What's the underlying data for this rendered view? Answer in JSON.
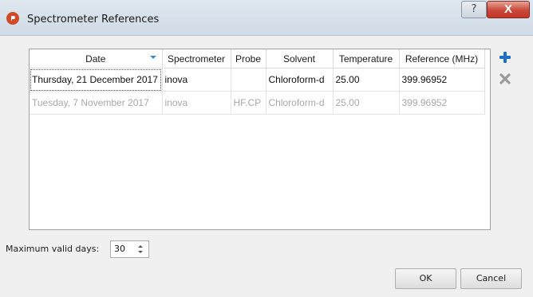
{
  "window": {
    "title": "Spectrometer References",
    "help_label": "?",
    "close_label": "X"
  },
  "table": {
    "columns": [
      "Date",
      "Spectrometer",
      "Probe",
      "Solvent",
      "Temperature",
      "Reference (MHz)"
    ],
    "rows": [
      {
        "date": "Thursday, 21 December 2017",
        "spectrometer": "inova",
        "probe": "",
        "solvent": "Chloroform-d",
        "temperature": "25.00",
        "reference": "399.96952",
        "state": "active"
      },
      {
        "date": "Tuesday, 7 November 2017",
        "spectrometer": "inova",
        "probe": "HF.CP",
        "solvent": "Chloroform-d",
        "temperature": "25.00",
        "reference": "399.96952",
        "state": "inactive"
      }
    ]
  },
  "side_buttons": {
    "add_icon": "plus-icon",
    "remove_icon": "x-icon"
  },
  "max_valid_days": {
    "label": "Maximum valid days:",
    "value": "30"
  },
  "buttons": {
    "ok": "OK",
    "cancel": "Cancel"
  },
  "colors": {
    "accent": "#1e6fc4",
    "close_button": "#c5352a",
    "inactive_text": "#a8a8a8"
  }
}
